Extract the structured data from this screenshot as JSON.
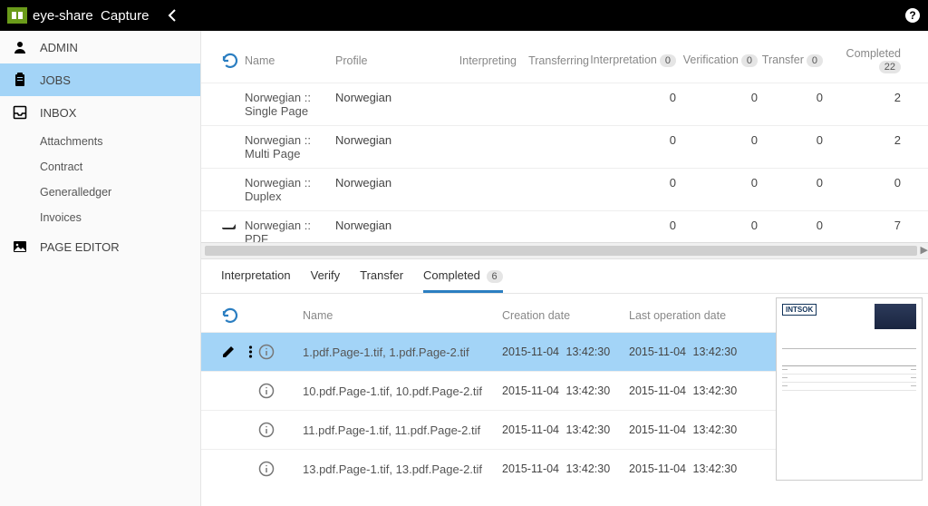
{
  "app": {
    "brand": "eye-share",
    "product": "Capture"
  },
  "sidebar": {
    "admin": "ADMIN",
    "jobs": "JOBS",
    "inbox": "INBOX",
    "subs": [
      "Attachments",
      "Contract",
      "Generalledger",
      "Invoices"
    ],
    "page_editor": "PAGE EDITOR"
  },
  "upper": {
    "headers": {
      "name": "Name",
      "profile": "Profile",
      "interpreting": "Interpreting",
      "transferring": "Transferring",
      "interpretation": "Interpretation",
      "verification": "Verification",
      "transfer": "Transfer",
      "completed": "Completed"
    },
    "badges": {
      "interpretation": "0",
      "verification": "0",
      "transfer": "0",
      "completed": "22"
    },
    "rows": [
      {
        "name": "Norwegian :: Single Page",
        "profile": "Norwegian",
        "interpreting": "",
        "transferring": "",
        "interpretation": "0",
        "verification": "0",
        "transfer": "0",
        "completed": "2"
      },
      {
        "name": "Norwegian :: Multi Page",
        "profile": "Norwegian",
        "interpreting": "",
        "transferring": "",
        "interpretation": "0",
        "verification": "0",
        "transfer": "0",
        "completed": "2"
      },
      {
        "name": "Norwegian :: Duplex",
        "profile": "Norwegian",
        "interpreting": "",
        "transferring": "",
        "interpretation": "0",
        "verification": "0",
        "transfer": "0",
        "completed": "0"
      },
      {
        "name": "Norwegian :: PDF",
        "profile": "Norwegian",
        "interpreting": "",
        "transferring": "",
        "interpretation": "0",
        "verification": "0",
        "transfer": "0",
        "completed": "7",
        "icon": true
      }
    ]
  },
  "tabs": {
    "interpretation": "Interpretation",
    "verify": "Verify",
    "transfer": "Transfer",
    "completed": "Completed",
    "completed_badge": "6"
  },
  "lower": {
    "headers": {
      "name": "Name",
      "creation": "Creation date",
      "lastop": "Last operation date"
    },
    "rows": [
      {
        "name": "1.pdf.Page-1.tif, 1.pdf.Page-2.tif",
        "cd_d": "2015-11-04",
        "cd_t": "13:42:30",
        "lo_d": "2015-11-04",
        "lo_t": "13:42:30",
        "selected": true
      },
      {
        "name": "10.pdf.Page-1.tif, 10.pdf.Page-2.tif",
        "cd_d": "2015-11-04",
        "cd_t": "13:42:30",
        "lo_d": "2015-11-04",
        "lo_t": "13:42:30"
      },
      {
        "name": "11.pdf.Page-1.tif, 11.pdf.Page-2.tif",
        "cd_d": "2015-11-04",
        "cd_t": "13:42:30",
        "lo_d": "2015-11-04",
        "lo_t": "13:42:30"
      },
      {
        "name": "13.pdf.Page-1.tif, 13.pdf.Page-2.tif",
        "cd_d": "2015-11-04",
        "cd_t": "13:42:30",
        "lo_d": "2015-11-04",
        "lo_t": "13:42:30"
      }
    ]
  },
  "preview": {
    "vendor": "INTSOK"
  }
}
